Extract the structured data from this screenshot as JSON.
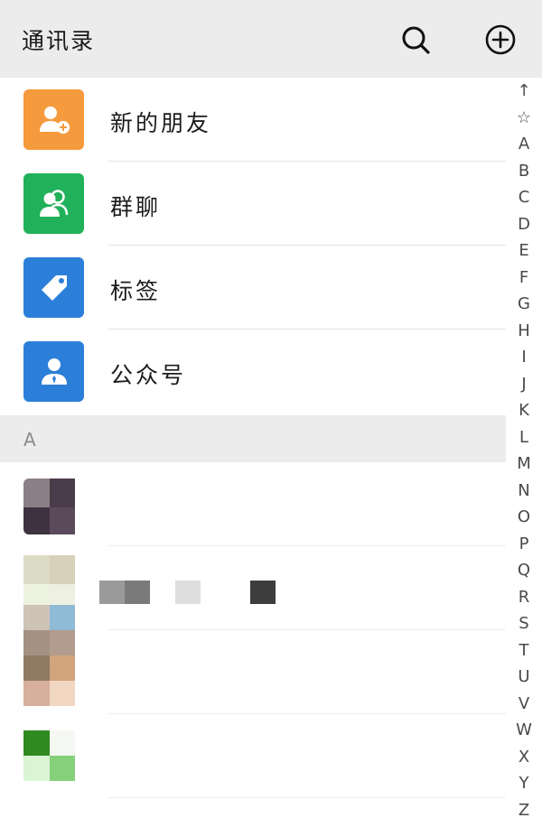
{
  "header": {
    "title": "通讯录"
  },
  "menu": [
    {
      "label": "新的朋友",
      "icon": "add-friend-icon",
      "color": "#f59a3d"
    },
    {
      "label": "群聊",
      "icon": "group-chat-icon",
      "color": "#21b15a"
    },
    {
      "label": "标签",
      "icon": "tag-icon",
      "color": "#2c7fd8"
    },
    {
      "label": "公众号",
      "icon": "official-account-icon",
      "color": "#2c7fd8"
    }
  ],
  "section": {
    "letter": "A"
  },
  "index": [
    "↑",
    "☆",
    "A",
    "B",
    "C",
    "D",
    "E",
    "F",
    "G",
    "H",
    "I",
    "J",
    "K",
    "L",
    "M",
    "N",
    "O",
    "P",
    "Q",
    "R",
    "S",
    "T",
    "U",
    "V",
    "W",
    "X",
    "Y",
    "Z"
  ]
}
